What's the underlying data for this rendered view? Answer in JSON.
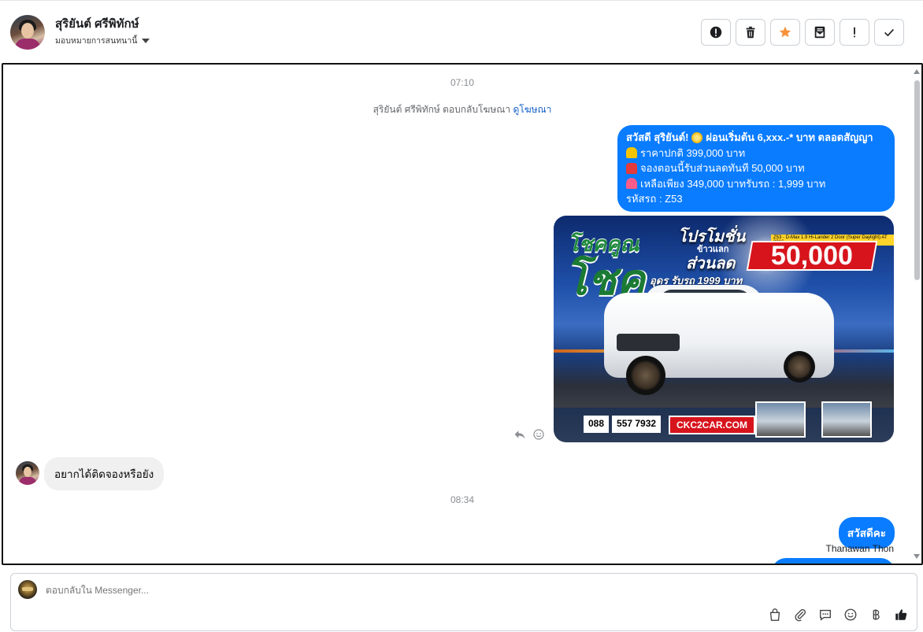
{
  "header": {
    "contact_name": "สุริยันต์ ศรีพิทักษ์",
    "assign_label": "มอบหมายการสนทนานี้",
    "toolbar": [
      {
        "name": "mark-spam-button",
        "icon": "alert-circle-icon"
      },
      {
        "name": "delete-button",
        "icon": "trash-icon"
      },
      {
        "name": "star-button",
        "icon": "star-icon"
      },
      {
        "name": "archive-button",
        "icon": "mail-archive-icon"
      },
      {
        "name": "follow-up-button",
        "icon": "exclamation-icon"
      },
      {
        "name": "mark-done-button",
        "icon": "check-icon"
      }
    ]
  },
  "conversation": {
    "time_1": "07:10",
    "system_message": {
      "text": "สุริยันต์ ศรีพิทักษ์ ตอบกลับโฆษณา",
      "link": "ดูโฆษณา"
    },
    "outgoing_ad_text": {
      "line1": "สวัสดี สุริยันต์!",
      "line1_rest": "ผ่อนเริ่มต้น 6,xxx.-* บาท ตลอดสัญญา",
      "line2": "ราคาปกติ 399,000 บาท",
      "line3": "จองตอนนี้รับส่วนลดทันที 50,000 บาท",
      "line4": "เหลือเพียง 349,000 บาทรับรถ : 1,999 บาท",
      "line5": "รหัสรถ : Z53"
    },
    "ad_image": {
      "headline_small": "โชคคูณ",
      "headline_big": "โชค",
      "promo": "โปรโมชั่น",
      "promo_fine": "Z53 - D-Max 1.9 Hi-Lander 2 Door (Super Daylight) AT 2016",
      "swap_label": "ข้าวแลก",
      "discount_label": "ส่วนลด",
      "amount": "50,000",
      "down_text": "อุดร รับรถ 1999 บาท",
      "phone_prefix": "088",
      "phone_number": "557 7932",
      "site": "CKC2CAR.COM"
    },
    "incoming_message": "อยากได้ติดจองหรือยัง",
    "time_2": "08:34",
    "outgoing_greeting": "สวัสดีคะ",
    "sender_name": "Thanawan Thon"
  },
  "composer": {
    "placeholder": "ตอบกลับใน Messenger...",
    "tools": [
      "shopping-bag-icon",
      "paperclip-icon",
      "saved-reply-icon",
      "emoji-icon",
      "baht-icon",
      "thumbs-up-icon"
    ]
  },
  "colors": {
    "accent": "#0a7cff",
    "star": "#f7923a",
    "link": "#1660c7"
  }
}
